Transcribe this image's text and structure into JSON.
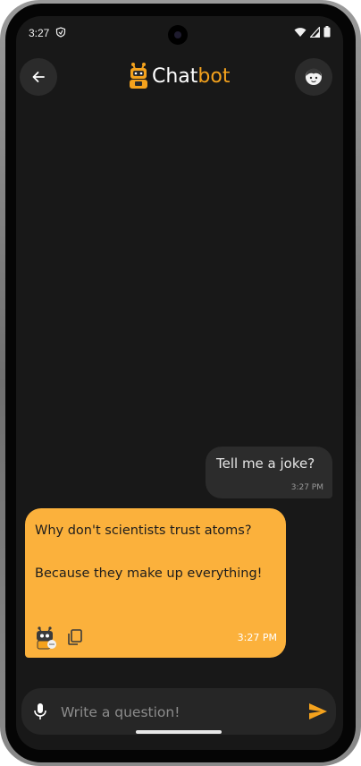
{
  "status_bar": {
    "time": "3:27"
  },
  "header": {
    "title_main": "Chat",
    "title_accent": "bot",
    "back_icon": "arrow-left-icon",
    "profile_icon": "user-face-icon",
    "logo_icon": "robot-logo-icon"
  },
  "messages": {
    "user": {
      "text": "Tell me a joke?",
      "time": "3:27 PM"
    },
    "bot": {
      "text": "Why don't scientists trust atoms?\n\nBecause they make up everything!",
      "time": "3:27 PM",
      "avatar_icon": "robot-avatar-icon",
      "copy_icon": "copy-icon"
    }
  },
  "input": {
    "placeholder": "Write a question!",
    "value": "",
    "mic_icon": "microphone-icon",
    "send_icon": "send-icon"
  },
  "colors": {
    "accent": "#f4a21d",
    "bot_bubble": "#fbb13c",
    "user_bubble": "#2c2c2c",
    "background": "#181818"
  }
}
